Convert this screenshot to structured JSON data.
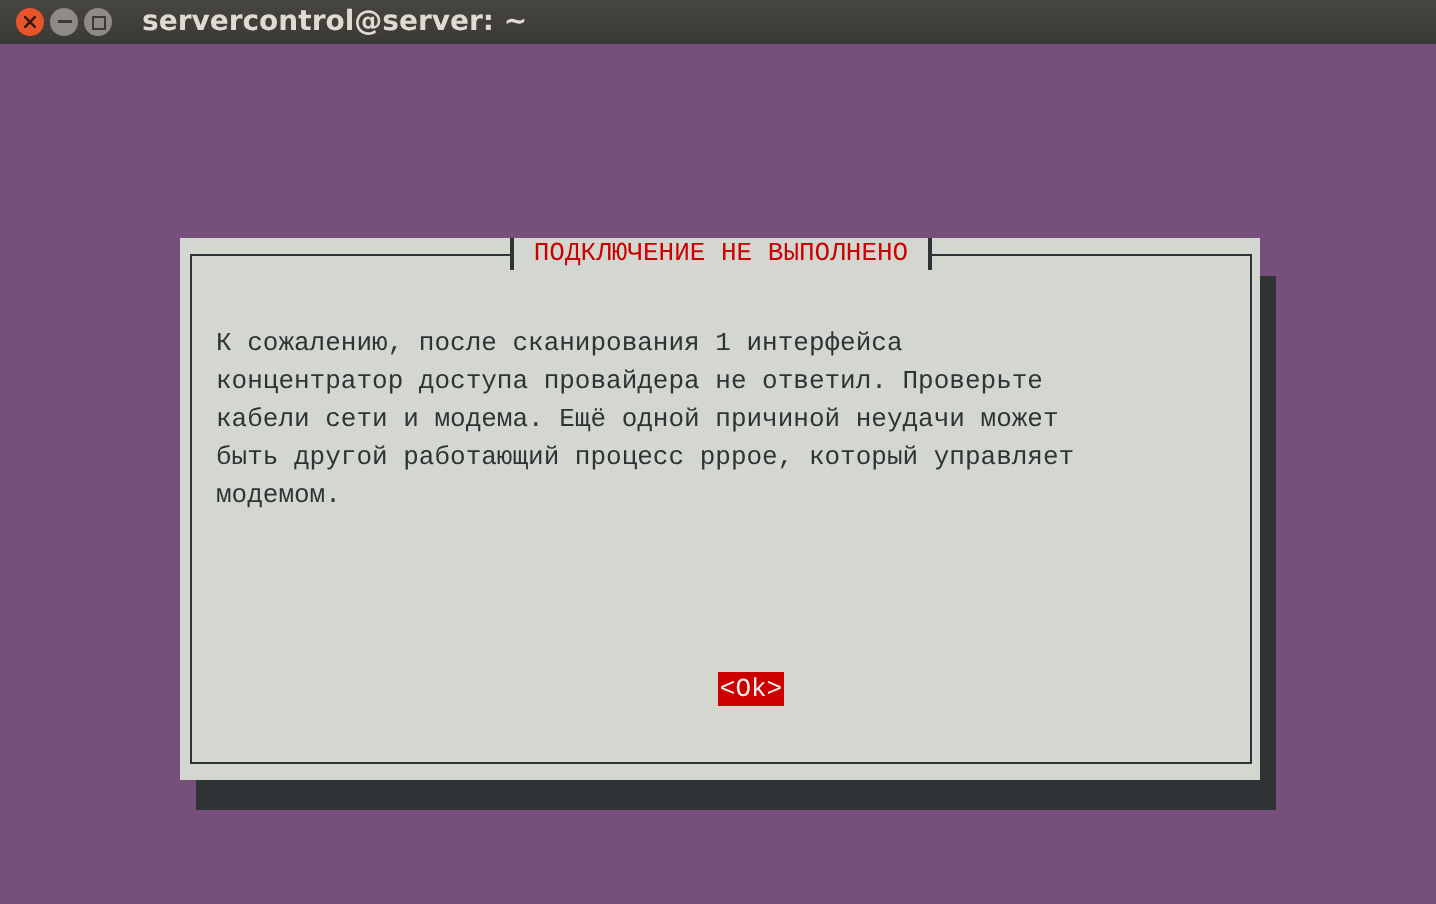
{
  "window": {
    "title": "servercontrol@server: ~"
  },
  "dialog": {
    "title": "ПОДКЛЮЧЕНИЕ НЕ ВЫПОЛНЕНО",
    "message": "К сожалению, после сканирования 1 интерфейса концентратор доступа провайдера не ответил. Проверьте кабели сети и модема. Ещё одной причиной неудачи может быть другой работающий процесс pppoe, который управляет модемом.",
    "buttons": [
      {
        "label": "<Ok>",
        "selected": true
      }
    ]
  }
}
